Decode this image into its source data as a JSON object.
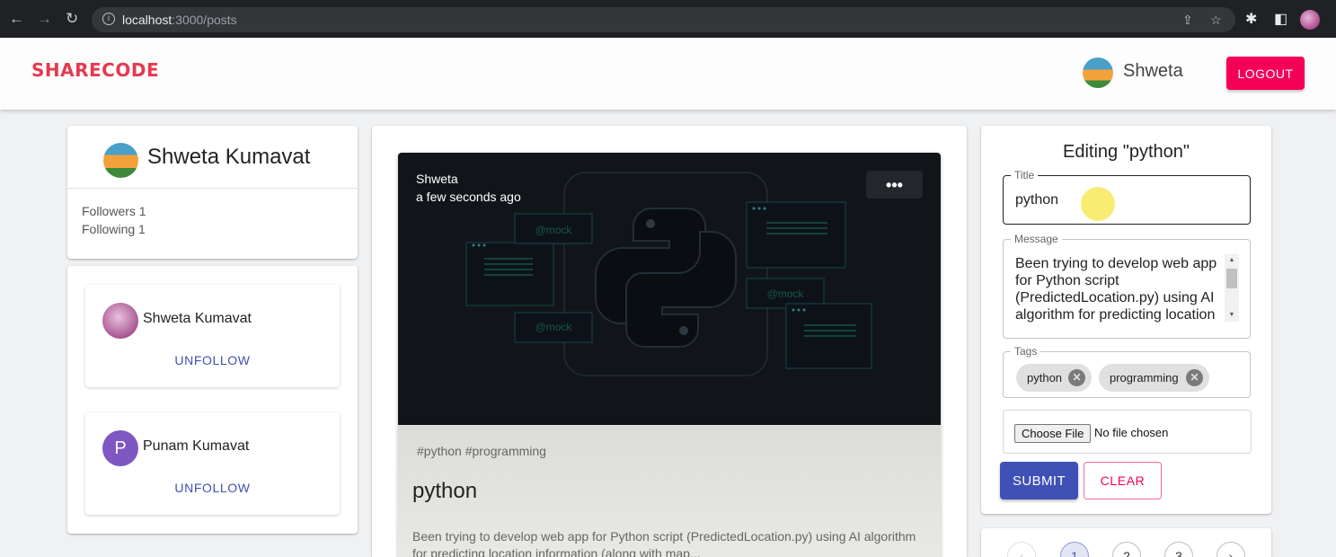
{
  "browser": {
    "url_host": "localhost",
    "url_path": ":3000/posts",
    "back_icon": "←",
    "forward_icon": "→",
    "reload_icon": "↻"
  },
  "header": {
    "logo": "SHARECODE",
    "user_name": "Shweta",
    "logout_label": "LOGOUT"
  },
  "profile": {
    "name": "Shweta Kumavat",
    "followers": "Followers 1",
    "following": "Following 1"
  },
  "follow_list": [
    {
      "name": "Shweta Kumavat",
      "button": "UNFOLLOW",
      "avatar_letter": ""
    },
    {
      "name": "Punam Kumavat",
      "button": "UNFOLLOW",
      "avatar_letter": "P"
    }
  ],
  "post": {
    "author": "Shweta",
    "time": "a few seconds ago",
    "menu": "•••",
    "tags": "#python #programming",
    "title": "python",
    "message": "Been trying to develop web app for Python script (PredictedLocation.py) using AI algorithm for predicting location information (along with map...",
    "image_labels": [
      "@mock",
      "@mock",
      "@mock"
    ]
  },
  "form": {
    "heading": "Editing \"python\"",
    "title_label": "Title",
    "title_value": "python",
    "message_label": "Message",
    "message_value": "Been trying to develop web app for Python script (PredictedLocation.py) using AI algorithm for predicting location",
    "tags_label": "Tags",
    "tags": [
      "python",
      "programming"
    ],
    "file_button": "Choose File",
    "file_status": "No file chosen",
    "submit_label": "SUBMIT",
    "clear_label": "CLEAR"
  },
  "pagination": {
    "prev": "‹",
    "pages": [
      "1",
      "2",
      "3"
    ],
    "current": "1",
    "next": "›"
  },
  "colors": {
    "brand": "#e53950",
    "logout": "#f50057",
    "primary": "#3f51b5"
  }
}
